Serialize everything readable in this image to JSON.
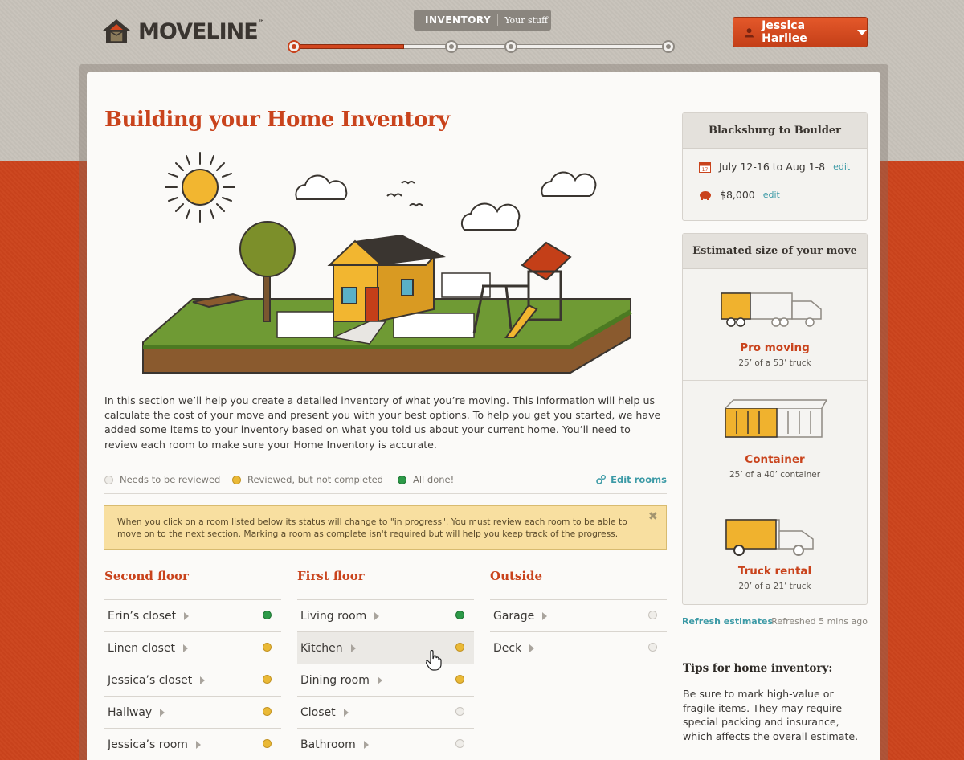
{
  "header": {
    "logo_text": "MOVELINE",
    "logo_tm": "™",
    "stage_tab": "INVENTORY",
    "stage_sub": "Your stuff",
    "progress": {
      "steps_total": 5,
      "current_step": 1,
      "fill_fraction": 0.28
    },
    "user_name": "Jessica Harllee",
    "colors": {
      "accent": "#c9431c",
      "link": "#3c9aa6"
    }
  },
  "main": {
    "title": "Building your Home Inventory",
    "intro": "In this section we’ll help you create a detailed inventory of what you’re moving. This information will help us calculate the cost of your move and present you with your best options. To help you get you started, we have added some items to your inventory based on what you told us about your current home. You’ll need to review each room to make sure your Home Inventory is accurate.",
    "legend": {
      "needs_review": "Needs to be reviewed",
      "reviewed": "Reviewed, but not completed",
      "done": "All done!",
      "edit_rooms": "Edit rooms"
    },
    "notice": "When you click on a room listed below its status will change to \"in progress\". You must review each room to be able to move on to the next section. Marking a room as complete isn't required but will help you keep track of the progress.",
    "columns": [
      {
        "title": "Second floor",
        "rooms": [
          {
            "name": "Erin’s closet",
            "status": "done"
          },
          {
            "name": "Linen closet",
            "status": "reviewed"
          },
          {
            "name": "Jessica’s closet",
            "status": "reviewed"
          },
          {
            "name": "Hallway",
            "status": "reviewed"
          },
          {
            "name": "Jessica’s room",
            "status": "reviewed"
          }
        ]
      },
      {
        "title": "First floor",
        "rooms": [
          {
            "name": "Living room",
            "status": "done"
          },
          {
            "name": "Kitchen",
            "status": "reviewed"
          },
          {
            "name": "Dining room",
            "status": "reviewed"
          },
          {
            "name": "Closet",
            "status": "needs_review"
          },
          {
            "name": "Bathroom",
            "status": "needs_review"
          }
        ]
      },
      {
        "title": "Outside",
        "rooms": [
          {
            "name": "Garage",
            "status": "needs_review"
          },
          {
            "name": "Deck",
            "status": "needs_review"
          }
        ]
      }
    ]
  },
  "sidebar": {
    "trip": {
      "title": "Blacksburg to Boulder",
      "dates": "July 12-16 to Aug 1-8",
      "calendar_day": "17",
      "budget": "$8,000",
      "edit": "edit"
    },
    "estimate": {
      "title": "Estimated size of your move",
      "options": [
        {
          "name": "Pro moving",
          "desc": "25’ of a 53’ truck",
          "fill_fraction": 0.47
        },
        {
          "name": "Container",
          "desc": "25’ of a 40’ container",
          "fill_fraction": 0.63
        },
        {
          "name": "Truck rental",
          "desc": "20’ of a 21’ truck",
          "fill_fraction": 0.95
        }
      ]
    },
    "refresh_link": "Refresh estimates",
    "refreshed": "Refreshed 5 mins ago",
    "tips": {
      "title": "Tips for home inventory:",
      "text": "Be sure to mark high-value or fragile items. They may require special packing and insurance, which affects the overall estimate."
    }
  }
}
